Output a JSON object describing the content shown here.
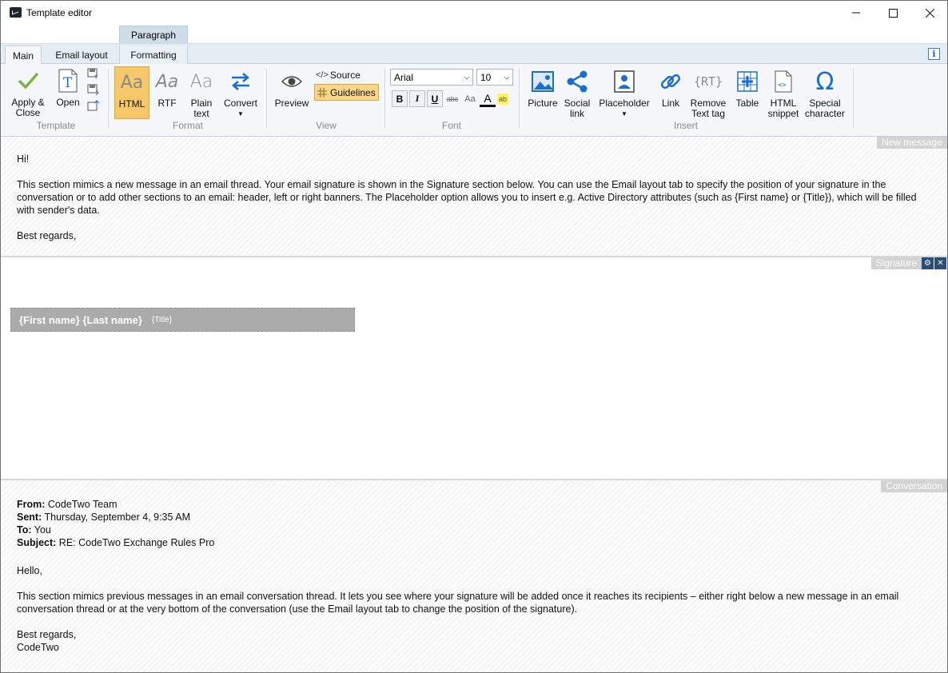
{
  "window": {
    "title": "Template editor"
  },
  "ribbon": {
    "context_tab": "Paragraph",
    "tabs": [
      "Main",
      "Email layout",
      "Formatting"
    ],
    "info": "i",
    "groups": {
      "template": {
        "label": "Template",
        "apply_close_line1": "Apply &",
        "apply_close_line2": "Close",
        "open": "Open"
      },
      "format": {
        "label": "Format",
        "html": "HTML",
        "rtf": "RTF",
        "plain_line1": "Plain",
        "plain_line2": "text",
        "convert": "Convert",
        "aa": "Aa"
      },
      "view": {
        "label": "View",
        "preview": "Preview",
        "source": "Source",
        "source_icon": "</>",
        "guidelines": "Guidelines"
      },
      "font": {
        "label": "Font",
        "family": "Arial",
        "size": "10",
        "bold": "B",
        "italic": "I",
        "underline": "U",
        "strike": "abc",
        "case": "Aa",
        "color": "A",
        "highlight": "ab"
      },
      "insert": {
        "label": "Insert",
        "picture": "Picture",
        "social_line1": "Social",
        "social_line2": "link",
        "placeholder": "Placeholder",
        "link": "Link",
        "remove_line1": "Remove",
        "remove_line2": "Text tag",
        "rt": "{RT}",
        "table": "Table",
        "snippet_line1": "HTML",
        "snippet_line2": "snippet",
        "special_line1": "Special",
        "special_line2": "character",
        "omega": "Ω"
      }
    }
  },
  "new_message": {
    "label": "New message",
    "greeting": "Hi!",
    "paragraph": "This section mimics a new message in an email thread. Your email signature is shown in the Signature section below. You can use the Email layout tab to specify the position of your signature in the conversation or to add other sections to an email: header, left or right banners. The Placeholder option allows you to insert e.g. Active Directory attributes (such as {First name} or {Title}), which will be filled with sender's data.",
    "closing": "Best regards,"
  },
  "signature": {
    "label": "Signature",
    "name": "{First name} {Last name}",
    "title": "{Title}",
    "gear": "⚙",
    "close": "✕"
  },
  "conversation": {
    "label": "Conversation",
    "from_label": "From:",
    "from_value": " CodeTwo Team",
    "sent_label": "Sent:",
    "sent_value": " Thursday, September 4, 9:35 AM",
    "to_label": "To:",
    "to_value": " You",
    "subject_label": "Subject:",
    "subject_value": " RE: CodeTwo Exchange Rules Pro",
    "greeting": "Hello,",
    "paragraph": "This section mimics previous messages in an email conversation thread. It lets you see where your signature will be added once it reaches its recipients – either right below a new message in an email conversation thread or at the very bottom of the conversation (use the Email layout tab to change the position of the signature).",
    "closing1": "Best regards,",
    "closing2": "CodeTwo"
  },
  "colors": {
    "accent": "#1a6fc9",
    "selected_format": "#f7c86a",
    "guidelines_bg": "#fbd68a"
  }
}
